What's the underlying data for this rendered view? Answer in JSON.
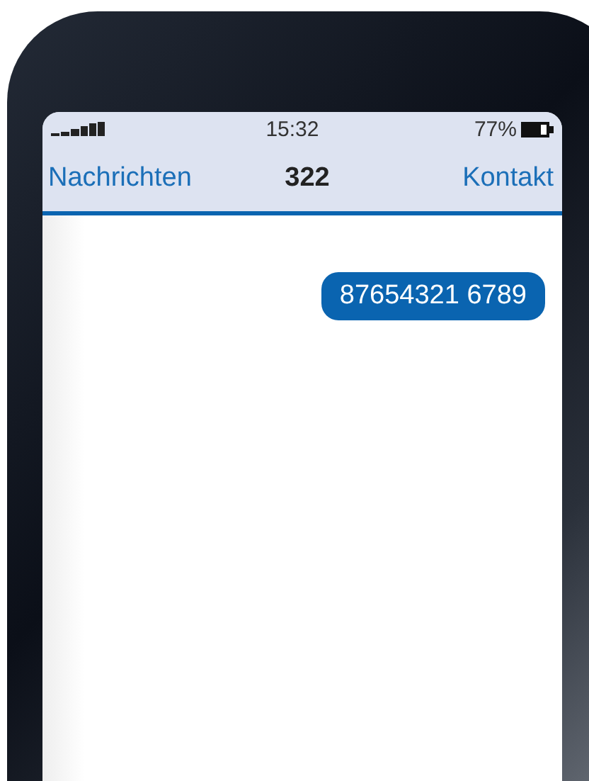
{
  "status_bar": {
    "time": "15:32",
    "battery": "77%"
  },
  "nav_bar": {
    "back": "Nachrichten",
    "title": "322",
    "action": "Kontakt"
  },
  "messages": [
    {
      "text": "87654321 6789",
      "kind": "sent"
    }
  ]
}
